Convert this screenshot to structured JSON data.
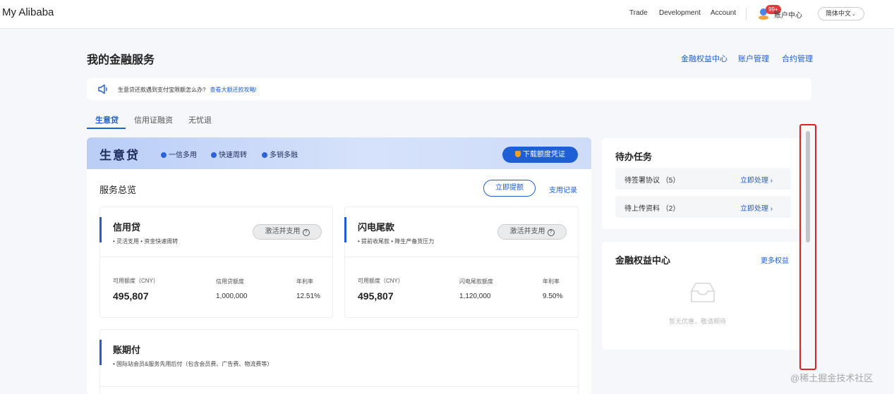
{
  "topbar": {
    "brand": "My Alibaba",
    "nav": [
      "Trade",
      "Development",
      "Account"
    ],
    "account_center": "账户中心",
    "badge": "99+",
    "language": "简体中文"
  },
  "page": {
    "title": "我的金融服务",
    "header_links": [
      "金融权益中心",
      "账户管理",
      "合约管理"
    ]
  },
  "notice": {
    "text": "生意贷还款遇到支付宝限额怎么办?",
    "link": "查看大额还款攻略!"
  },
  "tabs": [
    "生意贷",
    "信用证融资",
    "无忧退"
  ],
  "banner": {
    "title": "生意贷",
    "features": [
      "一信多用",
      "快速周转",
      "多销多融"
    ],
    "download_button": "下载额度凭证"
  },
  "overview": {
    "title": "服务总览",
    "withdraw_button": "立即提额",
    "record_link": "支用记录"
  },
  "cards": [
    {
      "title": "信用贷",
      "subtitle": "• 灵活支用  • 资金快速周转",
      "button": "激活并支用",
      "available_label": "可用额度（CNY）",
      "available_value": "495,807",
      "limit_label": "信用贷额度",
      "limit_value": "1,000,000",
      "rate_label": "年利率",
      "rate_value": "12.51%"
    },
    {
      "title": "闪电尾款",
      "subtitle": "• 提前收尾款  • 降生产备货压力",
      "button": "激活并支用",
      "available_label": "可用额度（CNY）",
      "available_value": "495,807",
      "limit_label": "闪电尾款额度",
      "limit_value": "1,120,000",
      "rate_label": "年利率",
      "rate_value": "9.50%"
    },
    {
      "title": "账期付",
      "subtitle": "• 国际站会员&服务先用后付（包含会员费、广告费、物流费等）"
    }
  ],
  "todo": {
    "title": "待办任务",
    "items": [
      {
        "name": "待签署协议 （5）",
        "action": "立即处理"
      },
      {
        "name": "待上传资料 （2）",
        "action": "立即处理"
      }
    ]
  },
  "benefits": {
    "title": "金融权益中心",
    "more": "更多权益",
    "empty": "暂无优惠，敬请期待"
  },
  "watermark": "@稀土掘金技术社区",
  "icons": {
    "notice": "speaker-icon",
    "account": "account-avatar-icon",
    "empty": "empty-inbox-icon",
    "task_arrow": "chevron-right-icon",
    "lang": "chevron-down-icon",
    "download": "medal-icon"
  },
  "colors": {
    "accent": "#1f5fd6",
    "highlight_frame": "#e02020",
    "badge": "#e4393c"
  }
}
